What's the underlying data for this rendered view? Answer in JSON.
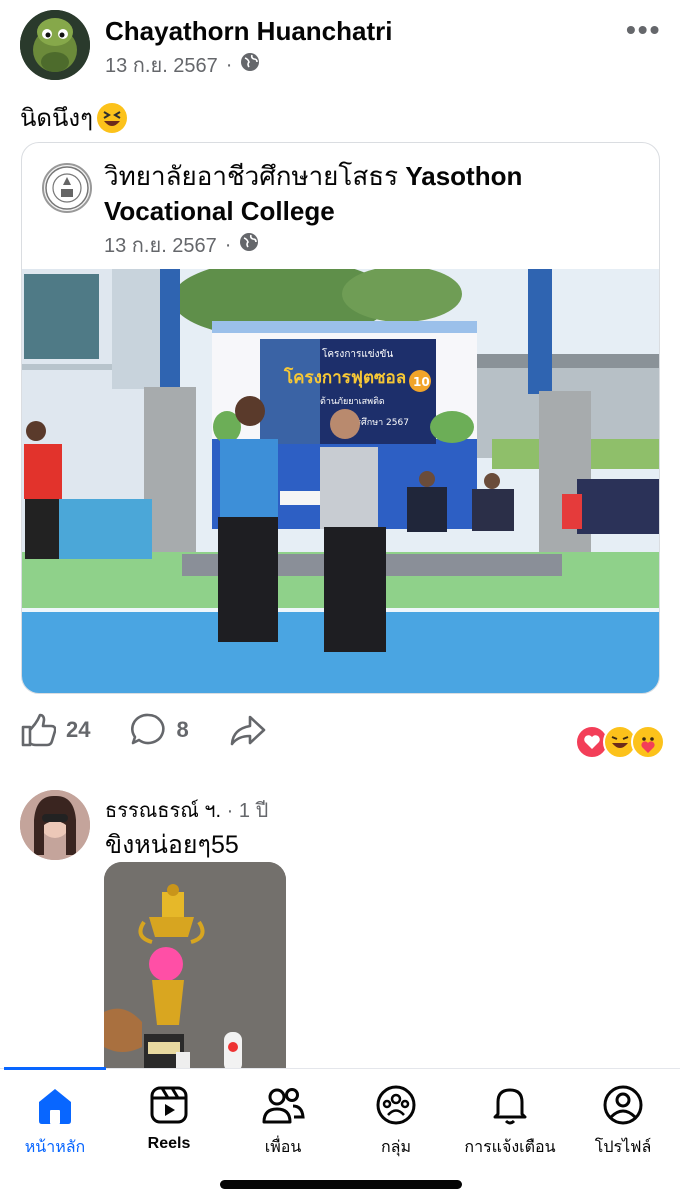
{
  "post": {
    "author": "Chayathorn Huanchatri",
    "date": "13 ก.ย. 2567",
    "separator": "·",
    "text": "นิดนึงๆ",
    "emoji": "grinning-squinting-face",
    "more_label": "•••"
  },
  "shared": {
    "page_name_th": "วิทยาลัยอาชีวศึกษายโสธร",
    "page_name_en": "Yasothon Vocational College",
    "date": "13 ก.ย. 2567",
    "separator": "·",
    "banner_lines": [
      "โครงการแข่งขัน",
      "โครงการฟุตซอล",
      "ต้านภัยยาเสพติด",
      "ปีการศึกษา 2567"
    ],
    "banner_badge": "10"
  },
  "actions": {
    "like_count": "24",
    "comment_count": "8",
    "reactions": [
      "love",
      "haha",
      "care"
    ]
  },
  "comment": {
    "author": "ธรรณธรณ์ ฯ.",
    "separator": "·",
    "time": "1 ปี",
    "text": "ขิงหน่อยๆ55"
  },
  "tabs": [
    {
      "label": "หน้าหลัก",
      "icon": "home-icon",
      "active": true
    },
    {
      "label": "Reels",
      "icon": "reels-icon",
      "active": false
    },
    {
      "label": "เพื่อน",
      "icon": "friends-icon",
      "active": false
    },
    {
      "label": "กลุ่ม",
      "icon": "groups-icon",
      "active": false
    },
    {
      "label": "การแจ้งเตือน",
      "icon": "bell-icon",
      "active": false
    },
    {
      "label": "โปรไฟล์",
      "icon": "profile-icon",
      "active": false
    }
  ],
  "colors": {
    "accent": "#0866ff",
    "secondary_text": "#65676b",
    "divider": "#dadde1"
  }
}
